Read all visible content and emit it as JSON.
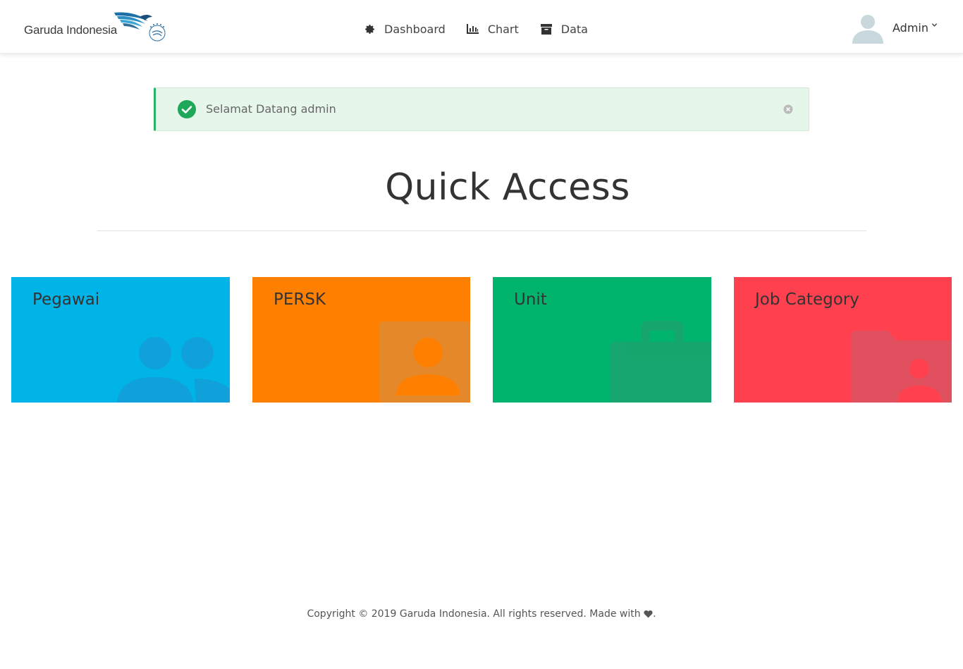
{
  "header": {
    "logo": {
      "text": "Garuda Indonesia"
    },
    "nav": [
      {
        "label": "Dashboard",
        "icon": "gear-icon"
      },
      {
        "label": "Chart",
        "icon": "bar-chart-icon"
      },
      {
        "label": "Data",
        "icon": "archive-icon"
      }
    ],
    "user": {
      "name": "Admin",
      "avatar_icon": "user-avatar-icon"
    }
  },
  "alert": {
    "message": "Selamat Datang admin",
    "color": "#e6f6ea",
    "accent": "#2bb464"
  },
  "main": {
    "title": "Quick Access",
    "cards": [
      {
        "label": "Pegawai",
        "color": "#00b4e8",
        "icon": "users-icon"
      },
      {
        "label": "PERSK",
        "color": "#ff8000",
        "icon": "user-portrait-icon"
      },
      {
        "label": "Unit",
        "color": "#00b46e",
        "icon": "briefcase-icon"
      },
      {
        "label": "Job Category",
        "color": "#ff414f",
        "icon": "folder-user-icon"
      }
    ]
  },
  "footer": {
    "text": "Copyright © 2019 Garuda Indonesia. All rights reserved. Made with",
    "suffix": "."
  }
}
